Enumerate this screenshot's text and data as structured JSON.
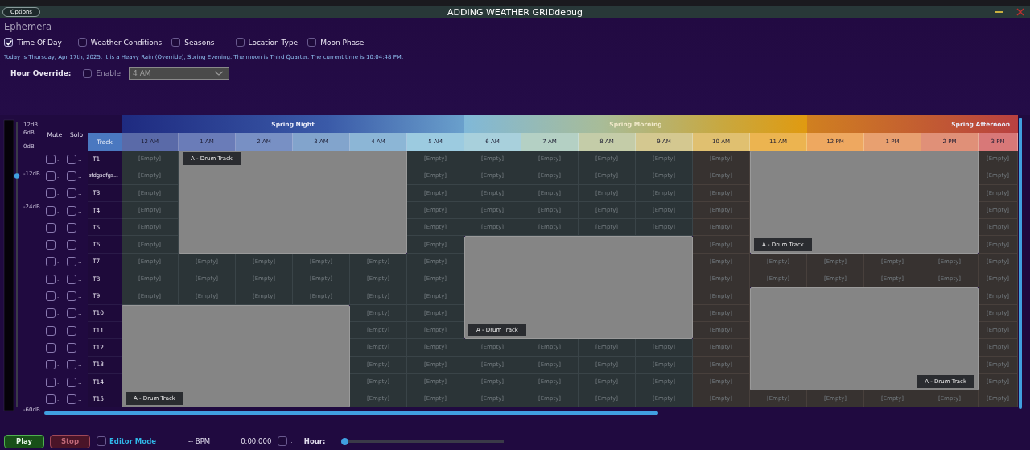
{
  "window": {
    "title": "ADDING WEATHER GRIDdebug",
    "options_button": "Options"
  },
  "panel_title": "Ephemera",
  "filters": [
    {
      "label": "Time Of Day",
      "checked": true
    },
    {
      "label": "Weather Conditions",
      "checked": false
    },
    {
      "label": "Seasons",
      "checked": false
    },
    {
      "label": "Location Type",
      "checked": false
    },
    {
      "label": "Moon Phase",
      "checked": false
    }
  ],
  "info": "Today is Thursday, Apr 17th, 2025. It is a Heavy Rain (Override), Spring Evening. The moon is Third Quarter. The current time is 10:04:48 PM.",
  "hour_override": {
    "label": "Hour Override:",
    "enable_label": "Enable",
    "enabled": false,
    "value": "4 AM"
  },
  "volume": {
    "level": 0.81,
    "scale": [
      "12dB",
      "6dB",
      "0dB",
      "-12dB",
      "-24dB",
      "-60dB"
    ]
  },
  "mute_header": "Mute",
  "solo_header": "Solo",
  "track_header": "Track",
  "seasons": [
    {
      "label": "Spring Night"
    },
    {
      "label": "Spring Morning"
    },
    {
      "label": "Spring Afternoon"
    }
  ],
  "hours": [
    "12 AM",
    "1 AM",
    "2 AM",
    "3 AM",
    "4 AM",
    "5 AM",
    "6 AM",
    "7 AM",
    "8 AM",
    "9 AM",
    "10 AM",
    "11 AM",
    "12 PM",
    "1 PM",
    "2 PM",
    "3 PM"
  ],
  "tracks": [
    {
      "name": "T1",
      "mute": false,
      "solo": false,
      "mute_label": "..",
      "solo_label": "..",
      "cells": [
        "[Empty]",
        null,
        null,
        null,
        null,
        "[Empty]",
        "[Empty]",
        "[Empty]",
        "[Empty]",
        "[Empty]",
        "[Empty]",
        null,
        null,
        null,
        null,
        "[Empty]"
      ]
    },
    {
      "name": "sfdgsdfgs...",
      "mute": false,
      "solo": false,
      "mute_label": "..",
      "solo_label": "..",
      "cells": [
        "[Empty]",
        null,
        null,
        null,
        null,
        "[Empty]",
        "[Empty]",
        "[Empty]",
        "[Empty]",
        "[Empty]",
        "[Empty]",
        null,
        null,
        null,
        null,
        "[Empty]"
      ]
    },
    {
      "name": "T3",
      "mute": false,
      "solo": false,
      "mute_label": "..",
      "solo_label": "..",
      "cells": [
        "[Empty]",
        null,
        null,
        null,
        null,
        "[Empty]",
        "[Empty]",
        "[Empty]",
        "[Empty]",
        "[Empty]",
        "[Empty]",
        null,
        null,
        null,
        null,
        "[Empty]"
      ]
    },
    {
      "name": "T4",
      "mute": false,
      "solo": false,
      "mute_label": "..",
      "solo_label": "..",
      "cells": [
        "[Empty]",
        null,
        null,
        null,
        null,
        "[Empty]",
        "[Empty]",
        "[Empty]",
        "[Empty]",
        "[Empty]",
        "[Empty]",
        null,
        null,
        null,
        null,
        "[Empty]"
      ]
    },
    {
      "name": "T5",
      "mute": false,
      "solo": false,
      "mute_label": "..",
      "solo_label": "..",
      "cells": [
        "[Empty]",
        null,
        null,
        null,
        null,
        "[Empty]",
        "[Empty]",
        "[Empty]",
        "[Empty]",
        "[Empty]",
        "[Empty]",
        null,
        null,
        null,
        null,
        "[Empty]"
      ]
    },
    {
      "name": "T6",
      "mute": false,
      "solo": false,
      "mute_label": "..",
      "solo_label": "..",
      "cells": [
        "[Empty]",
        null,
        null,
        null,
        null,
        "[Empty]",
        null,
        null,
        null,
        null,
        "[Empty]",
        null,
        null,
        null,
        null,
        "[Empty]"
      ]
    },
    {
      "name": "T7",
      "mute": false,
      "solo": false,
      "mute_label": "..",
      "solo_label": "..",
      "cells": [
        "[Empty]",
        "[Empty]",
        "[Empty]",
        "[Empty]",
        "[Empty]",
        "[Empty]",
        null,
        null,
        null,
        null,
        "[Empty]",
        "[Empty]",
        "[Empty]",
        "[Empty]",
        "[Empty]",
        "[Empty]"
      ]
    },
    {
      "name": "T8",
      "mute": false,
      "solo": false,
      "mute_label": "..",
      "solo_label": "..",
      "cells": [
        "[Empty]",
        "[Empty]",
        "[Empty]",
        "[Empty]",
        "[Empty]",
        "[Empty]",
        null,
        null,
        null,
        null,
        "[Empty]",
        "[Empty]",
        "[Empty]",
        "[Empty]",
        "[Empty]",
        "[Empty]"
      ]
    },
    {
      "name": "T9",
      "mute": false,
      "solo": false,
      "mute_label": "..",
      "solo_label": "..",
      "cells": [
        "[Empty]",
        "[Empty]",
        "[Empty]",
        "[Empty]",
        "[Empty]",
        "[Empty]",
        null,
        null,
        null,
        null,
        "[Empty]",
        null,
        null,
        null,
        null,
        "[Empty]"
      ]
    },
    {
      "name": "T10",
      "mute": false,
      "solo": false,
      "mute_label": "..",
      "solo_label": "..",
      "cells": [
        null,
        null,
        null,
        null,
        "[Empty]",
        "[Empty]",
        null,
        null,
        null,
        null,
        "[Empty]",
        null,
        null,
        null,
        null,
        "[Empty]"
      ]
    },
    {
      "name": "T11",
      "mute": false,
      "solo": false,
      "mute_label": "..",
      "solo_label": "..",
      "cells": [
        null,
        null,
        null,
        null,
        "[Empty]",
        "[Empty]",
        null,
        null,
        null,
        null,
        "[Empty]",
        null,
        null,
        null,
        null,
        "[Empty]"
      ]
    },
    {
      "name": "T12",
      "mute": false,
      "solo": false,
      "mute_label": "..",
      "solo_label": "..",
      "cells": [
        null,
        null,
        null,
        null,
        "[Empty]",
        "[Empty]",
        "[Empty]",
        "[Empty]",
        "[Empty]",
        "[Empty]",
        "[Empty]",
        null,
        null,
        null,
        null,
        "[Empty]"
      ]
    },
    {
      "name": "T13",
      "mute": false,
      "solo": false,
      "mute_label": "..",
      "solo_label": "..",
      "cells": [
        null,
        null,
        null,
        null,
        "[Empty]",
        "[Empty]",
        "[Empty]",
        "[Empty]",
        "[Empty]",
        "[Empty]",
        "[Empty]",
        null,
        null,
        null,
        null,
        "[Empty]"
      ]
    },
    {
      "name": "T14",
      "mute": false,
      "solo": false,
      "mute_label": "..",
      "solo_label": "..",
      "cells": [
        null,
        null,
        null,
        null,
        "[Empty]",
        "[Empty]",
        "[Empty]",
        "[Empty]",
        "[Empty]",
        "[Empty]",
        "[Empty]",
        null,
        null,
        null,
        null,
        "[Empty]"
      ]
    },
    {
      "name": "T15",
      "mute": false,
      "solo": false,
      "mute_label": "..",
      "solo_label": "..",
      "cells": [
        null,
        null,
        null,
        null,
        "[Empty]",
        "[Empty]",
        "[Empty]",
        "[Empty]",
        "[Empty]",
        "[Empty]",
        "[Empty]",
        "[Empty]",
        "[Empty]",
        "[Empty]",
        "[Empty]",
        "[Empty]"
      ]
    }
  ],
  "clips": [
    {
      "label": "A - Drum Track"
    },
    {
      "label": "A - Drum Track"
    },
    {
      "label": "A - Drum Track"
    },
    {
      "label": "A - Drum Track"
    },
    {
      "label": "A - Drum Track"
    }
  ],
  "transport": {
    "play": "Play",
    "stop": "Stop",
    "editor_mode": {
      "label": "Editor Mode",
      "checked": false
    },
    "bpm": "-- BPM",
    "time": "0:00:000",
    "extra": {
      "label": "..",
      "checked": false
    },
    "hour_label": "Hour:",
    "hour_slider": {
      "level": 0
    }
  }
}
